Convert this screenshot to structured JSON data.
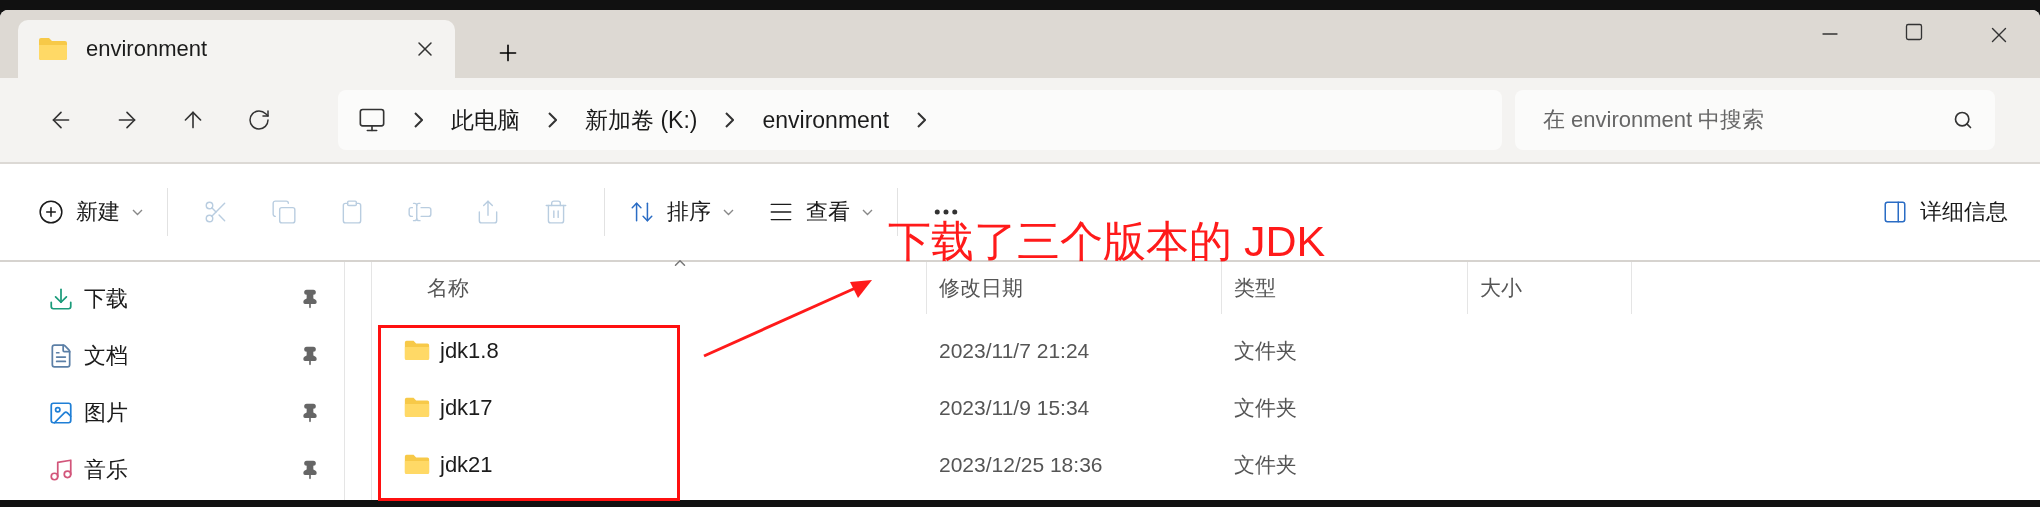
{
  "tabs": [
    {
      "title": "environment",
      "selected": true
    }
  ],
  "breadcrumbs": [
    "此电脑",
    "新加卷 (K:)",
    "environment"
  ],
  "search": {
    "placeholder": "在 environment 中搜索"
  },
  "toolbar": {
    "new_button": "新建",
    "actions": [
      {
        "disabled": true
      },
      {
        "disabled": true
      },
      {
        "disabled": true
      },
      {
        "disabled": true
      },
      {
        "disabled": true
      },
      {
        "disabled": true
      }
    ],
    "sort_button": "排序",
    "view_button": "查看",
    "details_button": "详细信息"
  },
  "sidebar": {
    "items": [
      {
        "label": "下载",
        "pinned": true
      },
      {
        "label": "文档",
        "pinned": true
      },
      {
        "label": "图片",
        "pinned": true
      },
      {
        "label": "音乐",
        "pinned": true
      }
    ]
  },
  "table": {
    "columns": [
      {
        "label": "名称",
        "sorted": true
      },
      {
        "label": "修改日期",
        "sorted": false
      },
      {
        "label": "类型",
        "sorted": false
      },
      {
        "label": "大小",
        "sorted": false
      }
    ],
    "rows": [
      {
        "name": "jdk1.8",
        "modified": "2023/11/7 21:24",
        "type": "文件夹"
      },
      {
        "name": "jdk17",
        "modified": "2023/11/9 15:34",
        "type": "文件夹"
      },
      {
        "name": "jdk21",
        "modified": "2023/12/25 18:36",
        "type": "文件夹"
      }
    ]
  },
  "annotation": {
    "text": "下载了三个版本的 JDK"
  }
}
